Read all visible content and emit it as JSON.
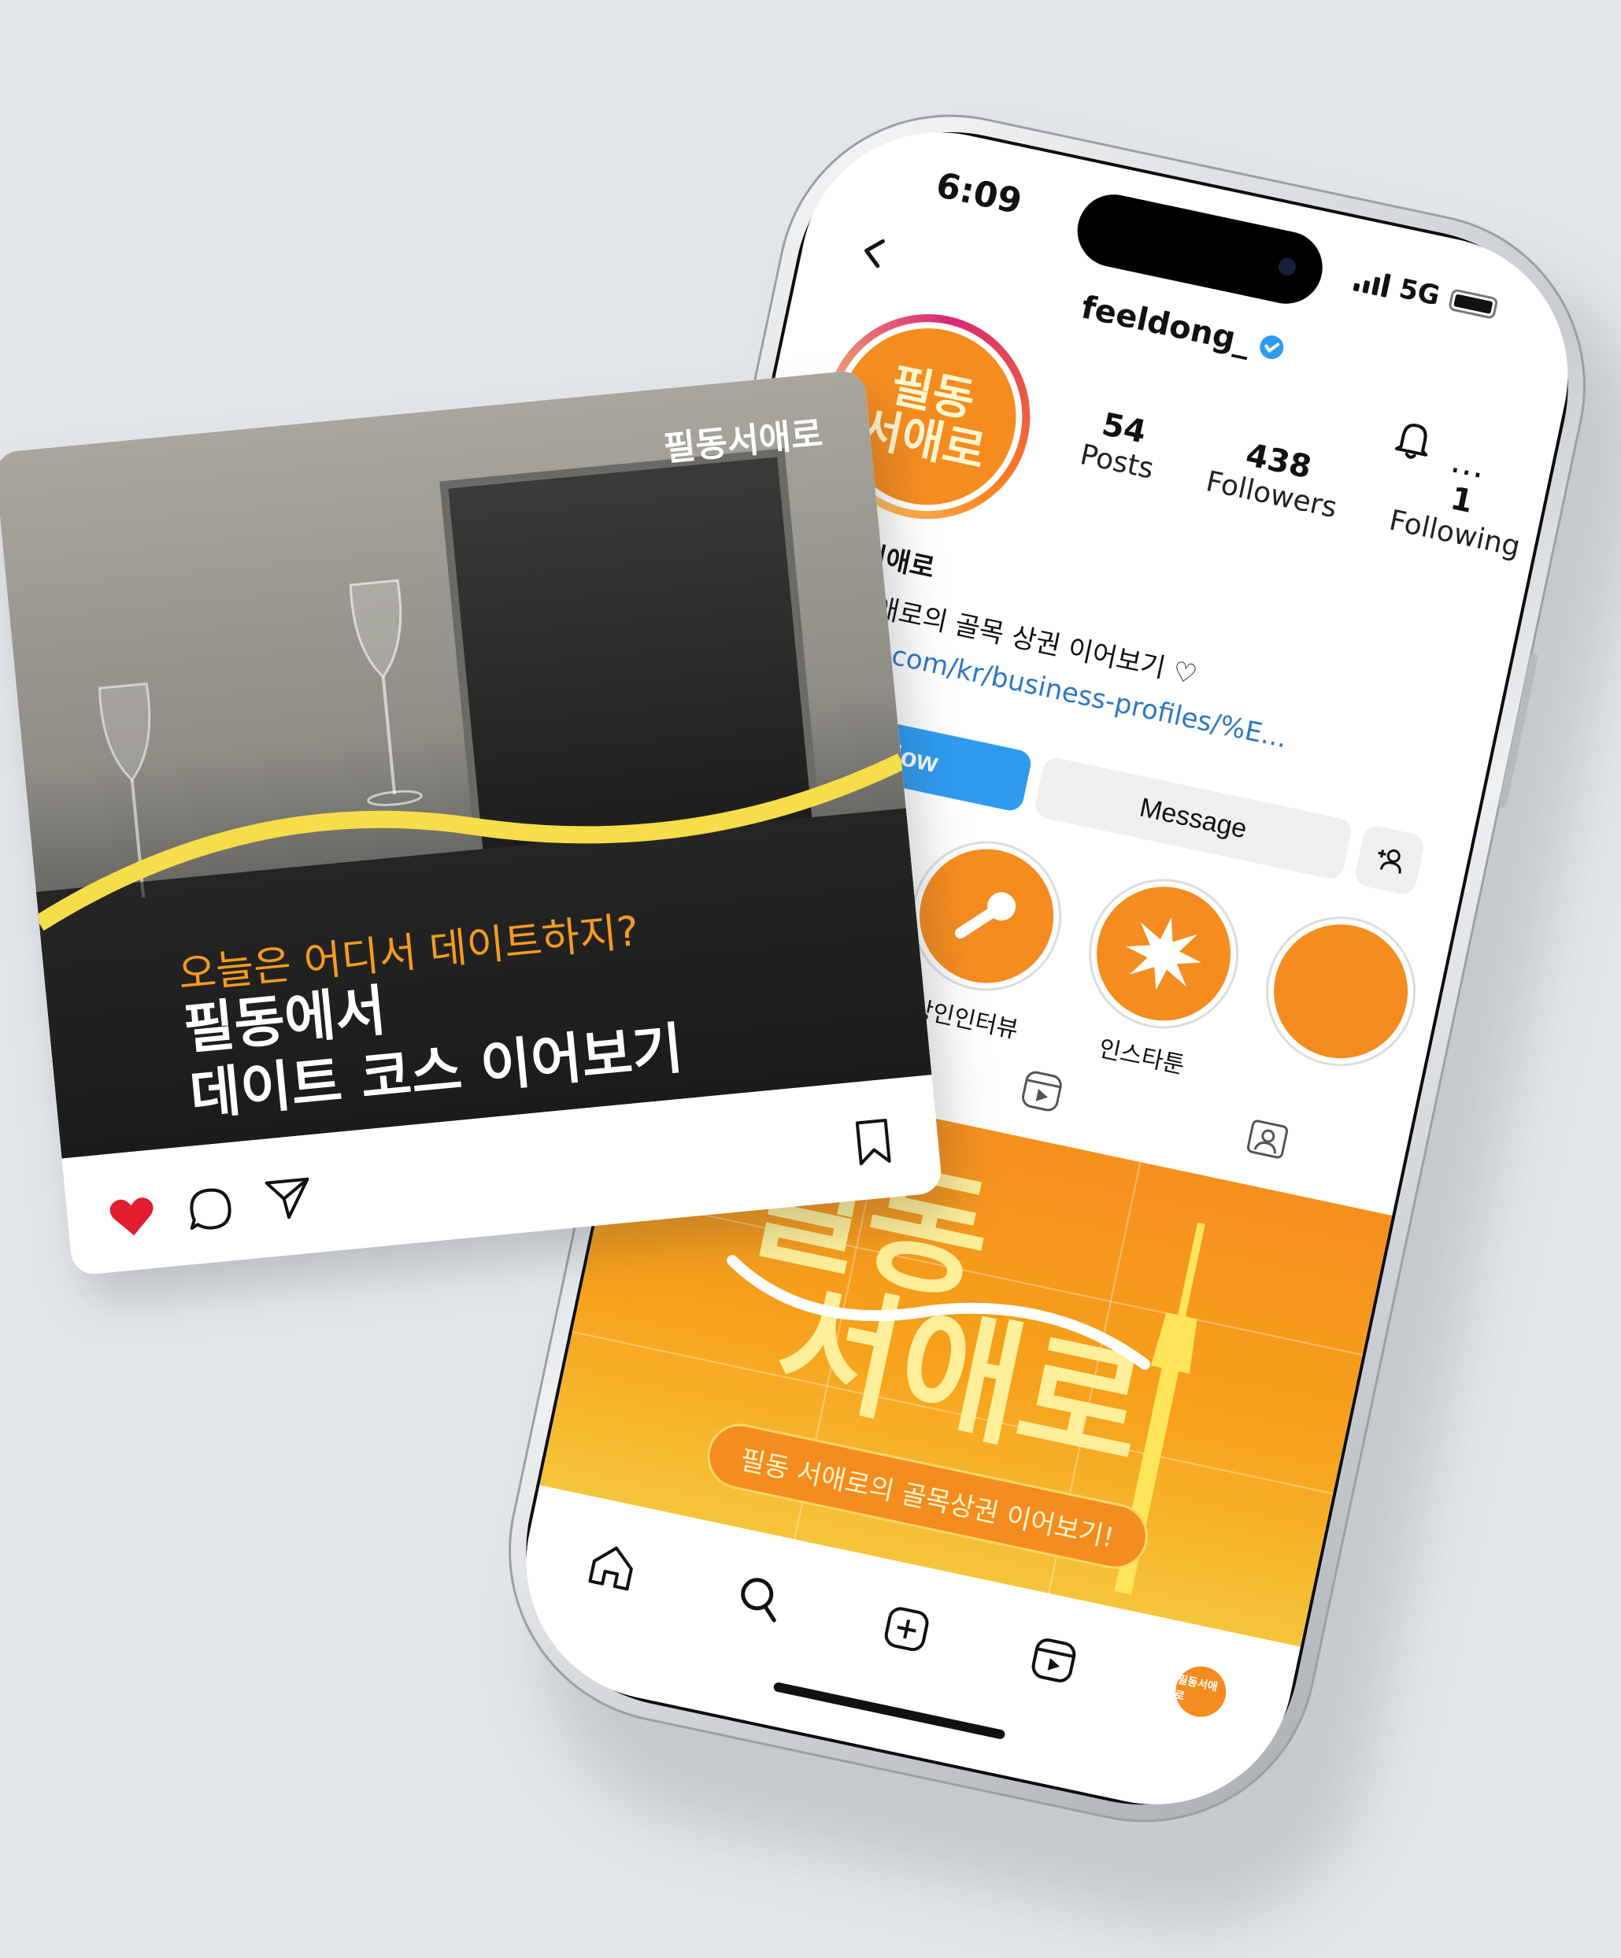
{
  "status_bar": {
    "time": "6:09",
    "network": "5G"
  },
  "profile": {
    "username": "feeldong_",
    "avatar_text_line1": "필동",
    "avatar_text_line2": "서애로",
    "stats": [
      {
        "number": "54",
        "label": "Posts"
      },
      {
        "number": "438",
        "label": "Followers"
      },
      {
        "number": "1",
        "label": "Following"
      }
    ],
    "bio_name": "필동 서애로",
    "bio_text": "필동 서애로의 골목 상권 이어보기 ♡",
    "bio_link": "daangn.com/kr/business-profiles/%E...",
    "follow_label": "Follow",
    "message_label": "Message"
  },
  "highlights": [
    {
      "label": "",
      "icon": "instagram-icon"
    },
    {
      "label": "상인인터뷰",
      "icon": "microphone-icon"
    },
    {
      "label": "인스타툰",
      "icon": "burst-icon"
    },
    {
      "label": "",
      "icon": "highlight-icon"
    }
  ],
  "grid_post": {
    "title_line1": "필동",
    "title_line2": "서애로",
    "banner": "필동 서애로의 골목상권 이어보기!"
  },
  "post_card": {
    "brand": "필동서애로",
    "question": "오늘은 어디서 데이트하지?",
    "title_line1": "필동에서",
    "title_line2": "데이트 코스 이어보기",
    "liked": true
  },
  "bottom_nav": {
    "avatar_text": "필동서애로"
  },
  "colors": {
    "brand_orange": "#f58c1f",
    "brand_yellow": "#ffef9a",
    "instagram_blue": "#2f9bf0",
    "like_red": "#e11d2e"
  }
}
